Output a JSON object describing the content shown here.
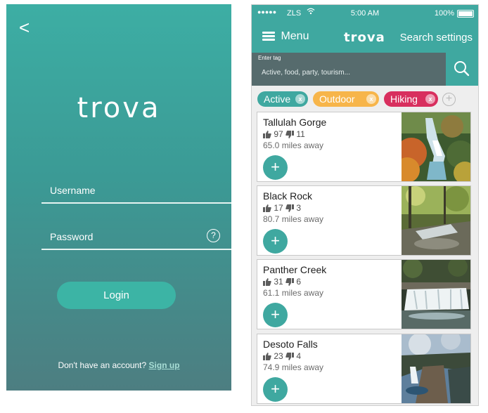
{
  "login": {
    "back_label": "<",
    "logo": "trova",
    "username_label": "Username",
    "password_label": "Password",
    "help_label": "?",
    "login_button": "Login",
    "signup_text": "Don't have an account?",
    "signup_link": "Sign up"
  },
  "status": {
    "signal": "●●●●●",
    "carrier": "ZLS",
    "time": "5:00 AM",
    "battery": "100%"
  },
  "nav": {
    "menu_label": "Menu",
    "brand": "trova",
    "search_settings": "Search settings"
  },
  "search": {
    "label": "Enter tag",
    "placeholder": "Active, food, party, tourism..."
  },
  "tags": [
    {
      "label": "Active",
      "color": "#3fa8a0"
    },
    {
      "label": "Outdoor",
      "color": "#f7b54a"
    },
    {
      "label": "Hiking",
      "color": "#d82f5e"
    }
  ],
  "tag_remove": "x",
  "add_tag": "+",
  "add_button": "+",
  "results": [
    {
      "name": "Tallulah Gorge",
      "up": "97",
      "down": "11",
      "distance": "65.0 miles away"
    },
    {
      "name": "Black Rock",
      "up": "17",
      "down": "3",
      "distance": "80.7 miles away"
    },
    {
      "name": "Panther Creek",
      "up": "31",
      "down": "6",
      "distance": "61.1 miles away"
    },
    {
      "name": "Desoto Falls",
      "up": "23",
      "down": "4",
      "distance": "74.9 miles away"
    }
  ]
}
